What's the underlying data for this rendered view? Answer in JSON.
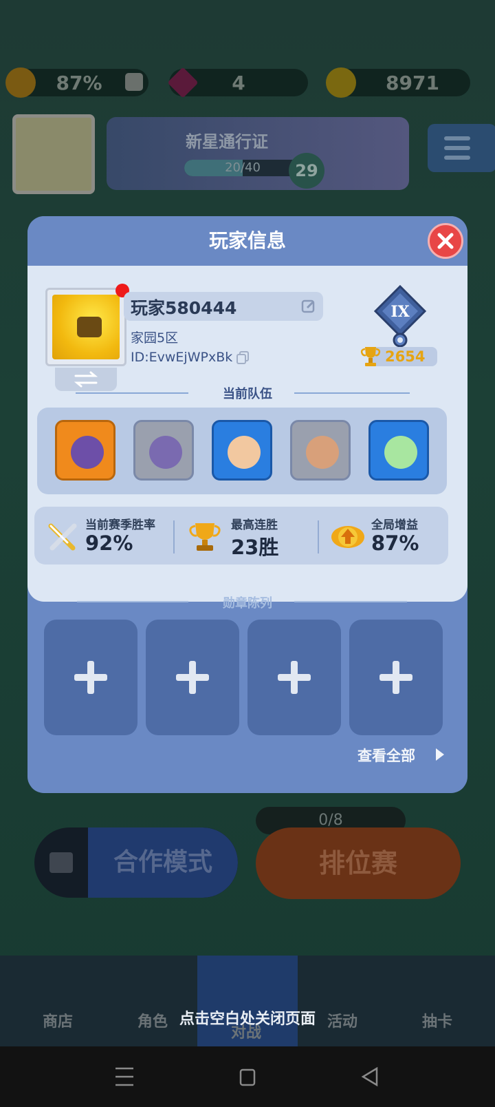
{
  "top_bar": {
    "boost_percent": "87%",
    "gems": "4",
    "coins": "8971"
  },
  "pass": {
    "title": "新星通行证",
    "progress_text": "20/40",
    "progress_fraction": 0.5,
    "level": "29"
  },
  "modal": {
    "title": "玩家信息",
    "player": {
      "name": "玩家580444",
      "zone": "家园5区",
      "id": "ID:EvwEjWPxBk",
      "rank_badge": "IX",
      "trophies": "2654"
    },
    "team_section_title": "当前队伍",
    "team": [
      {
        "name": "hero-1",
        "color": "#f08a1c"
      },
      {
        "name": "hero-2",
        "color": "#9aa0ae"
      },
      {
        "name": "hero-3",
        "color": "#2a7ee0"
      },
      {
        "name": "hero-4",
        "color": "#9aa0ae"
      },
      {
        "name": "hero-5",
        "color": "#2a7ee0"
      }
    ],
    "stats": [
      {
        "label": "当前赛季胜率",
        "value": "92%"
      },
      {
        "label": "最高连胜",
        "value": "23胜"
      },
      {
        "label": "全局增益",
        "value": "87%"
      }
    ],
    "medal_section_title": "勋章陈列",
    "medal_slots": 4,
    "view_all": "查看全部"
  },
  "background": {
    "ticket_progress": "0/8",
    "coop_mode": "合作模式",
    "ranked_mode": "排位赛",
    "nav": [
      "商店",
      "角色",
      "对战",
      "活动",
      "抽卡"
    ]
  },
  "close_hint": "点击空白处关闭页面",
  "colors": {
    "modal_header": "#6a89c4",
    "modal_body": "#dde7f4",
    "close_red": "#e84646",
    "trophy_gold": "#e6a412"
  }
}
